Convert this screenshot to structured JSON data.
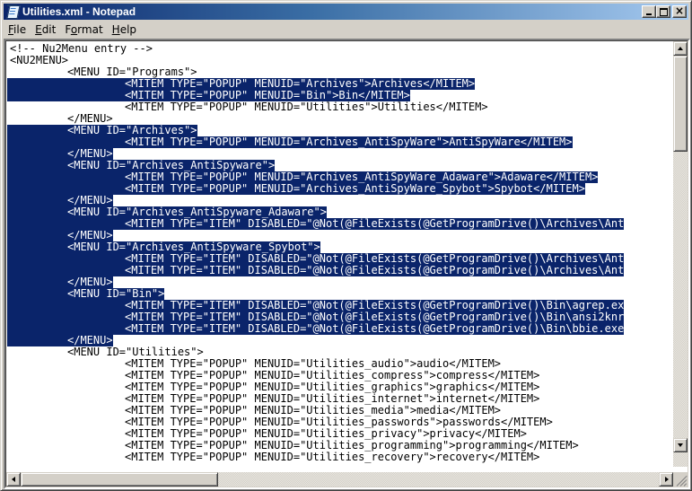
{
  "window": {
    "title": "Utilities.xml - Notepad",
    "controls": {
      "minimize": "minimize",
      "maximize": "maximize",
      "close": "close"
    }
  },
  "menubar": {
    "items": [
      {
        "label": "File",
        "accel": "F"
      },
      {
        "label": "Edit",
        "accel": "E"
      },
      {
        "label": "Format",
        "accel": "o"
      },
      {
        "label": "Help",
        "accel": "H"
      }
    ]
  },
  "editor": {
    "selection_color": "#0a246a",
    "lines": [
      {
        "indent": 0,
        "text": "<!-- Nu2Menu entry -->",
        "selected": false
      },
      {
        "indent": 0,
        "text": "<NU2MENU>",
        "selected": false
      },
      {
        "indent": 1,
        "text": "<MENU ID=\"Programs\">",
        "selected": false
      },
      {
        "indent": 2,
        "text": "<MITEM TYPE=\"POPUP\" MENUID=\"Archives\">Archives</MITEM>",
        "selected": true
      },
      {
        "indent": 2,
        "text": "<MITEM TYPE=\"POPUP\" MENUID=\"Bin\">Bin</MITEM>",
        "selected": true
      },
      {
        "indent": 2,
        "text": "<MITEM TYPE=\"POPUP\" MENUID=\"Utilities\">Utilities</MITEM>",
        "selected": false
      },
      {
        "indent": 1,
        "text": "</MENU>",
        "selected": false
      },
      {
        "indent": 1,
        "text": "<MENU ID=\"Archives\">",
        "selected": true
      },
      {
        "indent": 2,
        "text": "<MITEM TYPE=\"POPUP\" MENUID=\"Archives_AntiSpyWare\">AntiSpyWare</MITEM>",
        "selected": true
      },
      {
        "indent": 1,
        "text": "</MENU>",
        "selected": true
      },
      {
        "indent": 1,
        "text": "<MENU ID=\"Archives_AntiSpyware\">",
        "selected": true
      },
      {
        "indent": 2,
        "text": "<MITEM TYPE=\"POPUP\" MENUID=\"Archives_AntiSpyWare_Adaware\">Adaware</MITEM>",
        "selected": true
      },
      {
        "indent": 2,
        "text": "<MITEM TYPE=\"POPUP\" MENUID=\"Archives_AntiSpyWare_Spybot\">Spybot</MITEM>",
        "selected": true
      },
      {
        "indent": 1,
        "text": "</MENU>",
        "selected": true
      },
      {
        "indent": 1,
        "text": "<MENU ID=\"Archives_AntiSpyware_Adaware\">",
        "selected": true
      },
      {
        "indent": 2,
        "text": "<MITEM TYPE=\"ITEM\" DISABLED=\"@Not(@FileExists(@GetProgramDrive()\\Archives\\Ant",
        "selected": true
      },
      {
        "indent": 1,
        "text": "</MENU>",
        "selected": true
      },
      {
        "indent": 1,
        "text": "<MENU ID=\"Archives_AntiSpyware_Spybot\">",
        "selected": true
      },
      {
        "indent": 2,
        "text": "<MITEM TYPE=\"ITEM\" DISABLED=\"@Not(@FileExists(@GetProgramDrive()\\Archives\\Ant",
        "selected": true
      },
      {
        "indent": 2,
        "text": "<MITEM TYPE=\"ITEM\" DISABLED=\"@Not(@FileExists(@GetProgramDrive()\\Archives\\Ant",
        "selected": true
      },
      {
        "indent": 1,
        "text": "</MENU>",
        "selected": true
      },
      {
        "indent": 1,
        "text": "<MENU ID=\"Bin\">",
        "selected": true
      },
      {
        "indent": 2,
        "text": "<MITEM TYPE=\"ITEM\" DISABLED=\"@Not(@FileExists(@GetProgramDrive()\\Bin\\agrep.ex",
        "selected": true
      },
      {
        "indent": 2,
        "text": "<MITEM TYPE=\"ITEM\" DISABLED=\"@Not(@FileExists(@GetProgramDrive()\\Bin\\ansi2knr",
        "selected": true
      },
      {
        "indent": 2,
        "text": "<MITEM TYPE=\"ITEM\" DISABLED=\"@Not(@FileExists(@GetProgramDrive()\\Bin\\bbie.exe",
        "selected": true
      },
      {
        "indent": 1,
        "text": "</MENU>",
        "selected": true
      },
      {
        "indent": 1,
        "text": "<MENU ID=\"Utilities\">",
        "selected": false
      },
      {
        "indent": 2,
        "text": "<MITEM TYPE=\"POPUP\" MENUID=\"Utilities_audio\">audio</MITEM>",
        "selected": false
      },
      {
        "indent": 2,
        "text": "<MITEM TYPE=\"POPUP\" MENUID=\"Utilities_compress\">compress</MITEM>",
        "selected": false
      },
      {
        "indent": 2,
        "text": "<MITEM TYPE=\"POPUP\" MENUID=\"Utilities_graphics\">graphics</MITEM>",
        "selected": false
      },
      {
        "indent": 2,
        "text": "<MITEM TYPE=\"POPUP\" MENUID=\"Utilities_internet\">internet</MITEM>",
        "selected": false
      },
      {
        "indent": 2,
        "text": "<MITEM TYPE=\"POPUP\" MENUID=\"Utilities_media\">media</MITEM>",
        "selected": false
      },
      {
        "indent": 2,
        "text": "<MITEM TYPE=\"POPUP\" MENUID=\"Utilities_passwords\">passwords</MITEM>",
        "selected": false
      },
      {
        "indent": 2,
        "text": "<MITEM TYPE=\"POPUP\" MENUID=\"Utilities_privacy\">privacy</MITEM>",
        "selected": false
      },
      {
        "indent": 2,
        "text": "<MITEM TYPE=\"POPUP\" MENUID=\"Utilities_programming\">programming</MITEM>",
        "selected": false
      },
      {
        "indent": 2,
        "text": "<MITEM TYPE=\"POPUP\" MENUID=\"Utilities_recovery\">recovery</MITEM>",
        "selected": false
      }
    ]
  },
  "scrollbars": {
    "vertical": {
      "position_fraction": 0.0,
      "visible_fraction": 0.25
    },
    "horizontal": {
      "position_fraction": 0.0,
      "visible_fraction": 0.31
    }
  }
}
